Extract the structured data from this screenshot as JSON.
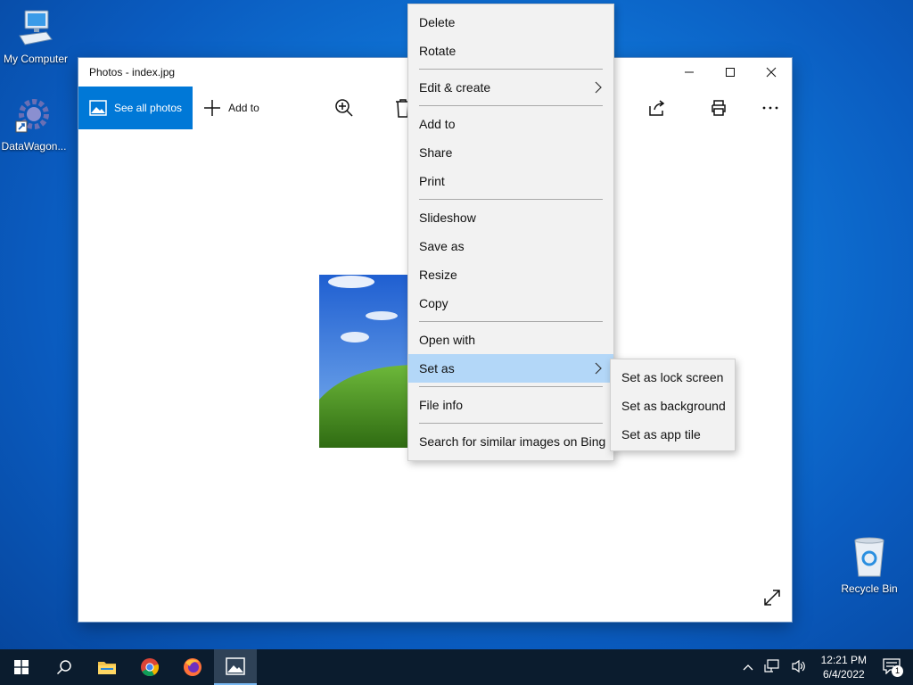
{
  "desktop": {
    "icons": [
      {
        "label": "My Computer"
      },
      {
        "label": "DataWagon..."
      },
      {
        "label": "Recycle Bin"
      }
    ]
  },
  "window": {
    "title": "Photos - index.jpg",
    "toolbar": {
      "see_all_label": "See all photos",
      "add_to_label": "Add to"
    }
  },
  "context_menu": {
    "items": [
      {
        "label": "Delete"
      },
      {
        "label": "Rotate"
      },
      {
        "label": "Edit & create",
        "submenu": true
      },
      {
        "label": "Add to"
      },
      {
        "label": "Share"
      },
      {
        "label": "Print"
      },
      {
        "label": "Slideshow"
      },
      {
        "label": "Save as"
      },
      {
        "label": "Resize"
      },
      {
        "label": "Copy"
      },
      {
        "label": "Open with"
      },
      {
        "label": "Set as",
        "submenu": true,
        "highlighted": true
      },
      {
        "label": "File info"
      },
      {
        "label": "Search for similar images on Bing"
      }
    ]
  },
  "submenu": {
    "items": [
      {
        "label": "Set as lock screen"
      },
      {
        "label": "Set as background"
      },
      {
        "label": "Set as app tile"
      }
    ]
  },
  "taskbar": {
    "clock_time": "12:21 PM",
    "clock_date": "6/4/2022",
    "notification_count": "1"
  },
  "colors": {
    "accent": "#0078d7",
    "menu_highlight": "#b3d7f8"
  }
}
